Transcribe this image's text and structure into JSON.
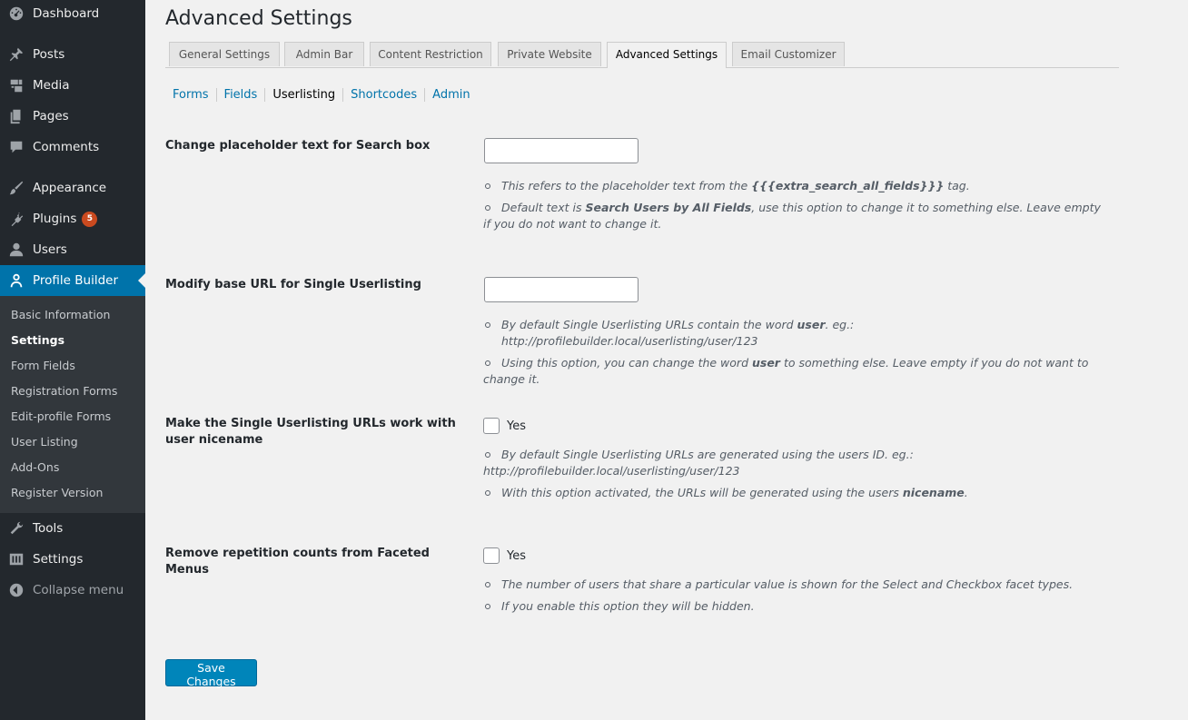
{
  "sidebar": {
    "menu": [
      {
        "label": "Dashboard",
        "icon": "dashboard-icon"
      },
      {
        "label": "Posts",
        "icon": "pushpin-icon"
      },
      {
        "label": "Media",
        "icon": "media-icon"
      },
      {
        "label": "Pages",
        "icon": "pages-icon"
      },
      {
        "label": "Comments",
        "icon": "comments-icon"
      },
      {
        "label": "Appearance",
        "icon": "paintbrush-icon"
      },
      {
        "label": "Plugins",
        "icon": "plugins-icon",
        "badge": "5"
      },
      {
        "label": "Users",
        "icon": "users-icon"
      },
      {
        "label": "Profile Builder",
        "icon": "profile-icon"
      },
      {
        "label": "Tools",
        "icon": "wrench-icon"
      },
      {
        "label": "Settings",
        "icon": "settings-icon"
      },
      {
        "label": "Collapse menu",
        "icon": "collapse-icon"
      }
    ],
    "submenu": [
      "Basic Information",
      "Settings",
      "Form Fields",
      "Registration Forms",
      "Edit-profile Forms",
      "User Listing",
      "Add-Ons",
      "Register Version"
    ]
  },
  "page": {
    "title": "Advanced Settings",
    "tabs": [
      "General Settings",
      "Admin Bar",
      "Content Restriction",
      "Private Website",
      "Advanced Settings",
      "Email Customizer"
    ],
    "subtabs": [
      "Forms",
      "Fields",
      "Userlisting",
      "Shortcodes",
      "Admin"
    ]
  },
  "settings": {
    "search_placeholder": {
      "label": "Change placeholder text for Search box",
      "value": "",
      "d1_pre": "This refers to the placeholder text from the ",
      "d1_bold": "{{{extra_search_all_fields}}}",
      "d1_post": " tag.",
      "d2_pre": "Default text is ",
      "d2_bold": "Search Users by All Fields",
      "d2_post": ", use this option to change it to something else. Leave empty if you do not want to change it."
    },
    "base_url": {
      "label": "Modify base URL for Single Userlisting",
      "value": "",
      "d1_pre": "By default Single Userlisting URLs contain the word ",
      "d1_bold": "user",
      "d1_post": ". eg.: http://profilebuilder.local/userlisting/user/123",
      "d2_pre": "Using this option, you can change the word ",
      "d2_bold": "user",
      "d2_post": " to something else. Leave empty if you do not want to change it."
    },
    "nicename": {
      "label": "Make the Single Userlisting URLs work with user nicename",
      "checkbox_label": "Yes",
      "d1": "By default Single Userlisting URLs are generated using the users ID. eg.: http://profilebuilder.local/userlisting/user/123",
      "d2_pre": "With this option activated, the URLs will be generated using the users ",
      "d2_bold": "nicename",
      "d2_post": "."
    },
    "facets": {
      "label": "Remove repetition counts from Faceted Menus",
      "checkbox_label": "Yes",
      "d1": "The number of users that share a particular value is shown for the Select and Checkbox facet types.",
      "d2": "If you enable this option they will be hidden."
    }
  },
  "save_label": "Save Changes"
}
